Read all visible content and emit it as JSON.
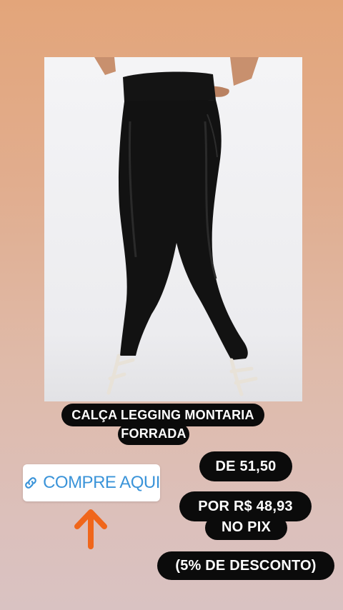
{
  "product": {
    "title_line1": "CALÇA LEGGING MONTARIA",
    "title_line2": "FORRADA",
    "image_icon": "product-photo"
  },
  "pricing": {
    "original": "DE 51,50",
    "promo_line1": "POR R$ 48,93",
    "promo_line2": "NO PIX",
    "discount": "(5% DE DESCONTO)"
  },
  "link_sticker": {
    "label": "COMPRE AQUI",
    "icon": "link-icon",
    "color": "#3b94d9"
  },
  "arrow": {
    "icon": "arrow-up-icon",
    "color": "#f0661b"
  }
}
